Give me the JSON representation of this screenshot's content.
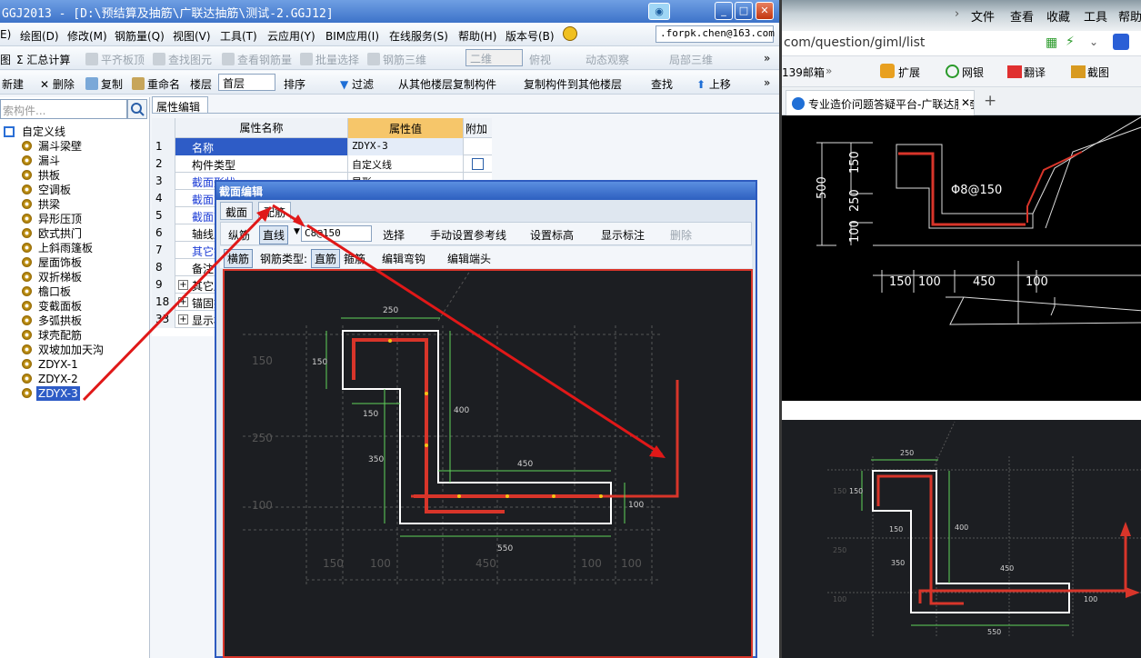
{
  "app": {
    "title": "GGJ2013 - [D:\\预结算及抽筋\\广联达抽筋\\测试-2.GGJ12]",
    "window_buttons": {
      "minimize": "_",
      "maximize": "□",
      "close": "✕"
    },
    "menu": [
      "绘图(D)",
      "修改(M)",
      "钢筋量(Q)",
      "视图(V)",
      "工具(T)",
      "云应用(Y)",
      "BIM应用(I)",
      "在线服务(S)",
      "帮助(H)",
      "版本号(B)"
    ],
    "menu_prefix": "E)",
    "user": ".forpk.chen@163.com",
    "toolbar1": {
      "sum": "Σ 汇总计算",
      "flat": "平齐板顶",
      "find": "查找图元",
      "view_rebar": "查看钢筋量",
      "batch": "批量选择",
      "rebar3d": "钢筋三维",
      "mode": "二维",
      "topview": "俯视",
      "dynamic": "动态观察",
      "local3d": "局部三维"
    },
    "toolbar2": {
      "new": "新建",
      "delete": "删除",
      "copy": "复制",
      "rename": "重命名",
      "floor_label": "楼层",
      "floor": "首层",
      "sort": "排序",
      "filter": "过滤",
      "copy_from": "从其他楼层复制构件",
      "copy_to": "复制构件到其他楼层",
      "find": "查找",
      "moveup": "上移"
    },
    "search_placeholder": "索构件...",
    "tree": {
      "root": "自定义线",
      "items": [
        "漏斗梁壁",
        "漏斗",
        "拱板",
        "空调板",
        "拱梁",
        "异形压顶",
        "欧式拱门",
        "上斜雨篷板",
        "屋面饰板",
        "双折梯板",
        "檐口板",
        "变截面板",
        "多弧拱板",
        "球壳配筋",
        "双坡加加天沟",
        "ZDYX-1",
        "ZDYX-2",
        "ZDYX-3"
      ],
      "selected": "ZDYX-3"
    },
    "prop_tab": "属性编辑",
    "grid": {
      "headers": [
        "属性名称",
        "属性值",
        "附加"
      ],
      "rows": [
        {
          "no": "1",
          "name": "名称",
          "value": "ZDYX-3"
        },
        {
          "no": "2",
          "name": "构件类型",
          "value": "自定义线"
        },
        {
          "no": "3",
          "name": "截面形状",
          "value": "异形"
        },
        {
          "no": "4",
          "name": "截面宽度",
          "value": ""
        },
        {
          "no": "5",
          "name": "截面高度",
          "value": ""
        },
        {
          "no": "6",
          "name": "轴线距左",
          "value": ""
        },
        {
          "no": "7",
          "name": "其它钢筋",
          "value": ""
        },
        {
          "no": "8",
          "name": "备注",
          "value": ""
        },
        {
          "no": "9",
          "name": "其它属性",
          "value": ""
        },
        {
          "no": "18",
          "name": "锚固搭接",
          "value": ""
        },
        {
          "no": "33",
          "name": "显示样式",
          "value": ""
        }
      ]
    },
    "dialog": {
      "title": "截面编辑",
      "tabs": [
        "截面",
        "配筋"
      ],
      "tool1": {
        "long": "纵筋",
        "line": "直线",
        "spec": "C8@150",
        "select": "选择",
        "ref": "手动设置参考线",
        "elev": "设置标高",
        "show": "显示标注",
        "del": "删除"
      },
      "tool2": {
        "horiz": "横筋",
        "type_label": "钢筋类型:",
        "straight": "直筋",
        "stirrup": "箍筋",
        "edit_bend": "编辑弯钩",
        "edit_end": "编辑端头"
      },
      "dims": {
        "top": "250",
        "left_top": "150",
        "mid_left": "150",
        "right": "400",
        "left_mid": "350",
        "bottom_inner": "450",
        "right_small": "100",
        "bottom": "550"
      },
      "grid_labels": {
        "l1": "150",
        "l2": "250",
        "l3": "100",
        "b1": "150",
        "b2": "100",
        "b3": "450",
        "b4": "100",
        "b5": "100"
      }
    }
  },
  "browser": {
    "menu": [
      "文件",
      "查看",
      "收藏",
      "工具",
      "帮助"
    ],
    "address": "com/question/giml/list",
    "favorites": [
      "139邮箱",
      "扩展",
      "网银",
      "翻译",
      "截图"
    ],
    "tab_title": "专业造价问题答疑平台-广联达服务新干线",
    "new_tab": "+",
    "cad": {
      "h500": "500",
      "h150": "150",
      "h250": "250",
      "h100": "100",
      "rebar": "Φ8@150",
      "w150": "150",
      "w100a": "100",
      "w450": "450",
      "w100b": "100"
    },
    "thumb": {
      "top": "250",
      "lt": "150",
      "ml": "150",
      "r": "400",
      "lm": "350",
      "bi": "450",
      "rs": "100",
      "b": "550",
      "g1": "150",
      "g2": "250",
      "g3": "100"
    }
  }
}
